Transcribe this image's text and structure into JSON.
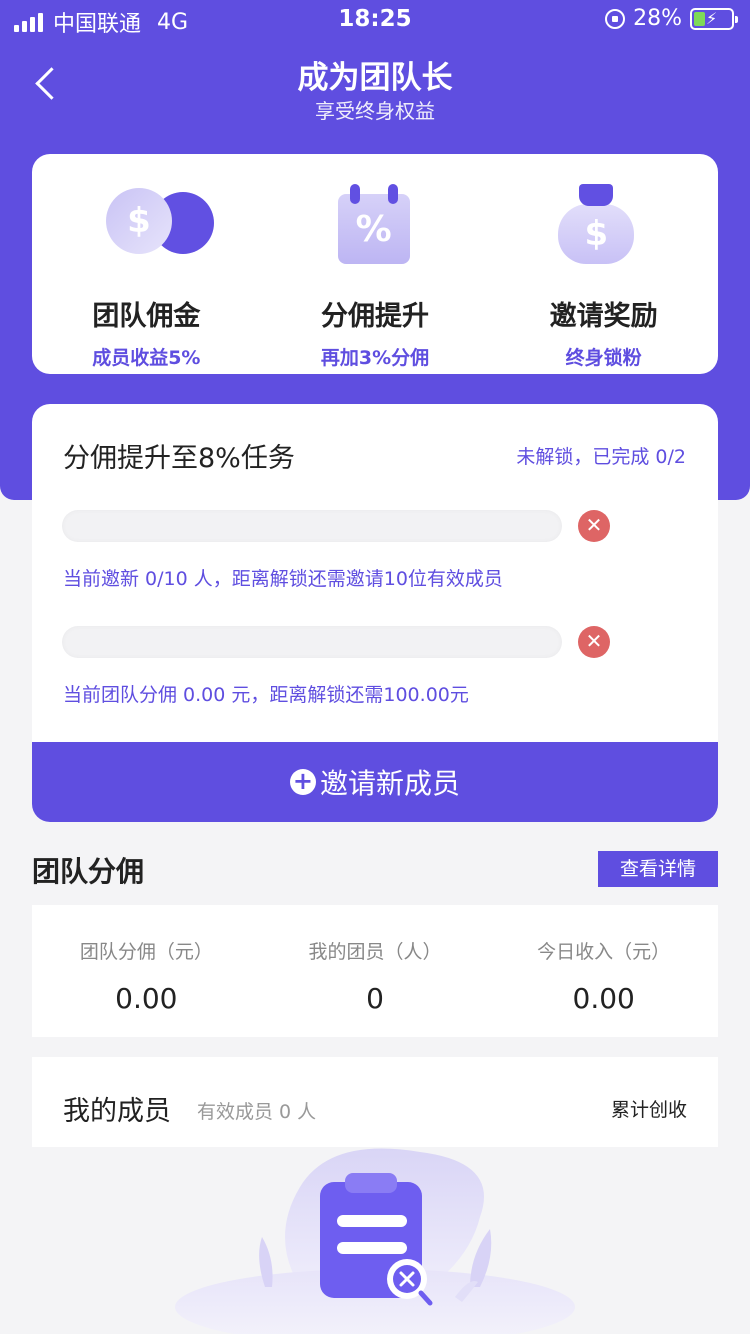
{
  "status_bar": {
    "carrier": "中国联通",
    "network": "4G",
    "time": "18:25",
    "battery": "28%"
  },
  "header": {
    "title": "成为团队长",
    "subtitle": "享受终身权益"
  },
  "benefits": [
    {
      "icon": "coin-icon",
      "title": "团队佣金",
      "subtitle": "成员收益5%"
    },
    {
      "icon": "percent-calendar-icon",
      "title": "分佣提升",
      "subtitle": "再加3%分佣"
    },
    {
      "icon": "money-bag-icon",
      "title": "邀请奖励",
      "subtitle": "终身锁粉"
    }
  ],
  "task": {
    "title": "分佣提升至8%任务",
    "status": "未解锁，已完成 0/2",
    "items": [
      {
        "progress": 0,
        "description": "当前邀新 0/10 人，距离解锁还需邀请10位有效成员"
      },
      {
        "progress": 0,
        "description": "当前团队分佣 0.00 元，距离解锁还需100.00元"
      }
    ],
    "invite_label": "邀请新成员"
  },
  "team_commission": {
    "title": "团队分佣",
    "detail_label": "查看详情",
    "stats": [
      {
        "label": "团队分佣（元）",
        "value": "0.00"
      },
      {
        "label": "我的团员（人）",
        "value": "0"
      },
      {
        "label": "今日收入（元）",
        "value": "0.00"
      }
    ]
  },
  "members": {
    "title": "我的成员",
    "count": "有效成员 0 人",
    "total_label": "累计创收"
  },
  "colors": {
    "primary": "#5f4ee0",
    "danger": "#de6565",
    "background": "#f4f4f6"
  }
}
